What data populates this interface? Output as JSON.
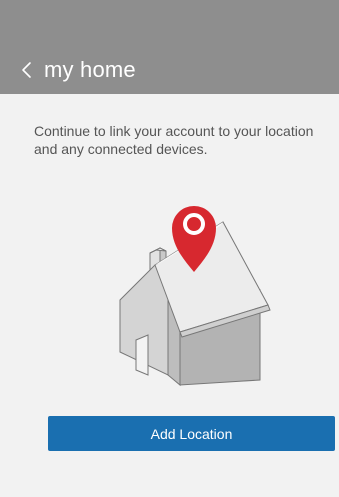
{
  "header": {
    "title": "my home",
    "back_icon": "chevron-left-icon",
    "background": "#8e8e8e"
  },
  "main": {
    "description": "Continue to link your account to your location and any connected devices.",
    "illustration": "house-location-pin-icon",
    "pin_color": "#d7282f"
  },
  "actions": {
    "add_location_label": "Add Location",
    "button_color": "#1a6fb0"
  }
}
